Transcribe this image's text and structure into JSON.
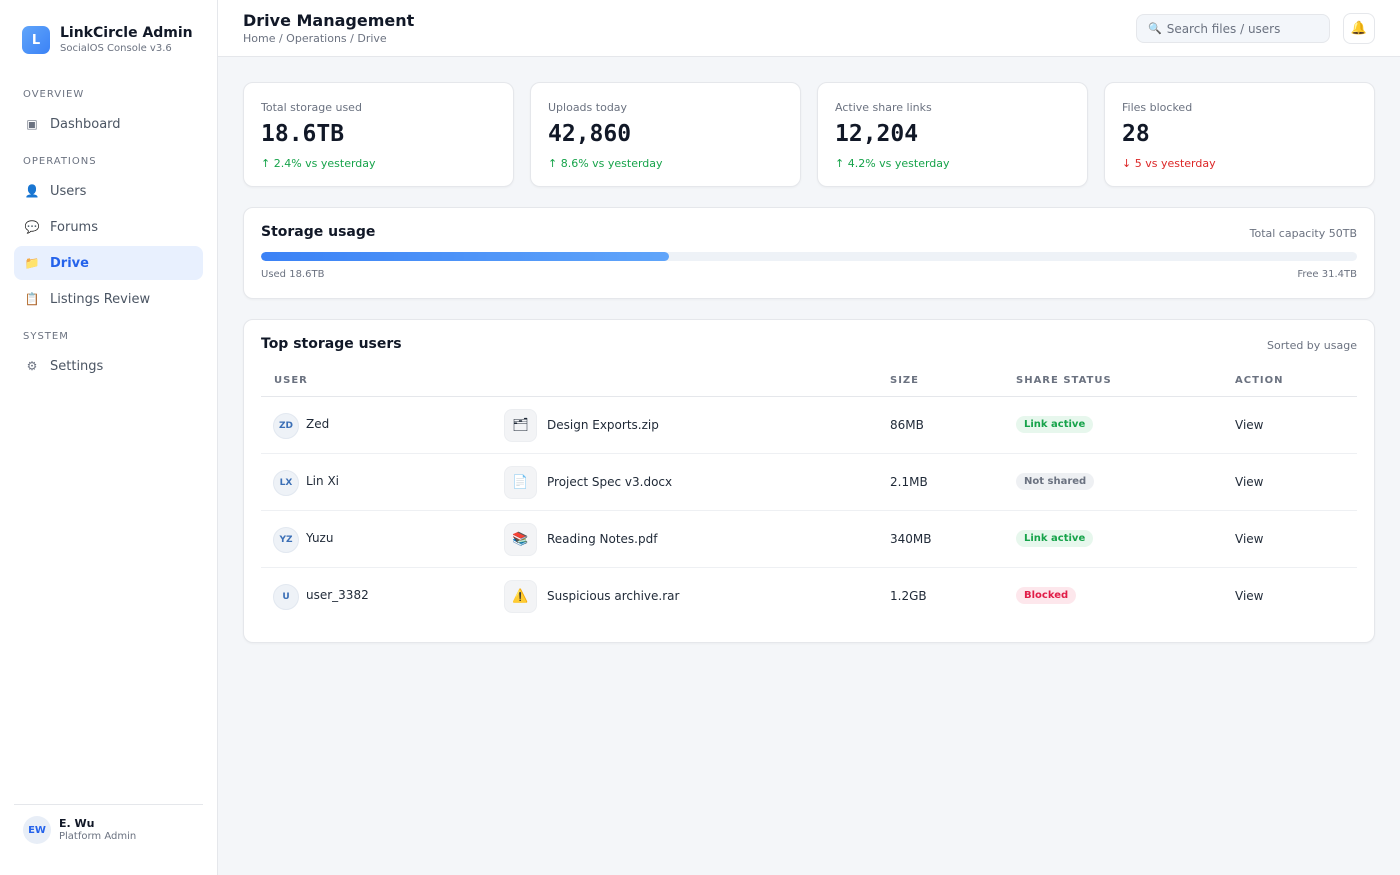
{
  "sidebar": {
    "brand_logo": "L",
    "brand_name": "LinkCircle Admin",
    "brand_sub": "SocialOS Console v3.6",
    "sections": {
      "overview": "OVERVIEW",
      "operations": "OPERATIONS",
      "system": "SYSTEM"
    },
    "items": {
      "dashboard": {
        "icon": "▣",
        "label": "Dashboard"
      },
      "users": {
        "icon": "👤",
        "label": "Users"
      },
      "forums": {
        "icon": "💬",
        "label": "Forums"
      },
      "drive": {
        "icon": "📁",
        "label": "Drive"
      },
      "listings": {
        "icon": "📋",
        "label": "Listings Review"
      },
      "settings": {
        "icon": "⚙",
        "label": "Settings"
      }
    },
    "user": {
      "initials": "EW",
      "name": "E. Wu",
      "role": "Platform Admin"
    }
  },
  "header": {
    "title": "Drive Management",
    "breadcrumb": "Home / Operations / Drive",
    "search_icon": "🔍",
    "search_placeholder": "Search files / users",
    "bell_icon": "🔔"
  },
  "stats": [
    {
      "label": "Total storage used",
      "value": "18.6TB",
      "delta": "↑ 2.4% vs yesterday",
      "trend": "up"
    },
    {
      "label": "Uploads today",
      "value": "42,860",
      "delta": "↑ 8.6% vs yesterday",
      "trend": "up"
    },
    {
      "label": "Active share links",
      "value": "12,204",
      "delta": "↑ 4.2% vs yesterday",
      "trend": "up"
    },
    {
      "label": "Files blocked",
      "value": "28",
      "delta": "↓ 5 vs yesterday",
      "trend": "down"
    }
  ],
  "storage": {
    "title": "Storage usage",
    "capacity_label": "Total capacity 50TB",
    "used_label": "Used 18.6TB",
    "free_label": "Free 31.4TB",
    "used_fraction": 0.372
  },
  "top_users": {
    "title": "Top storage users",
    "sort_label": "Sorted by usage",
    "columns": {
      "user": "USER",
      "size": "SIZE",
      "status": "SHARE STATUS",
      "action": "ACTION"
    },
    "rows": [
      {
        "initials": "ZD",
        "user": "Zed",
        "file_icon": "🗂",
        "file": "Design Exports.zip",
        "size": "86MB",
        "status": "Link active",
        "status_kind": "active",
        "action": "View"
      },
      {
        "initials": "LX",
        "user": "Lin Xi",
        "file_icon": "📄",
        "file": "Project Spec v3.docx",
        "size": "2.1MB",
        "status": "Not shared",
        "status_kind": "none",
        "action": "View"
      },
      {
        "initials": "YZ",
        "user": "Yuzu",
        "file_icon": "📚",
        "file": "Reading Notes.pdf",
        "size": "340MB",
        "status": "Link active",
        "status_kind": "active",
        "action": "View"
      },
      {
        "initials": "U",
        "user": "user_3382",
        "file_icon": "⚠️",
        "file": "Suspicious archive.rar",
        "size": "1.2GB",
        "status": "Blocked",
        "status_kind": "blocked",
        "action": "View"
      }
    ]
  }
}
